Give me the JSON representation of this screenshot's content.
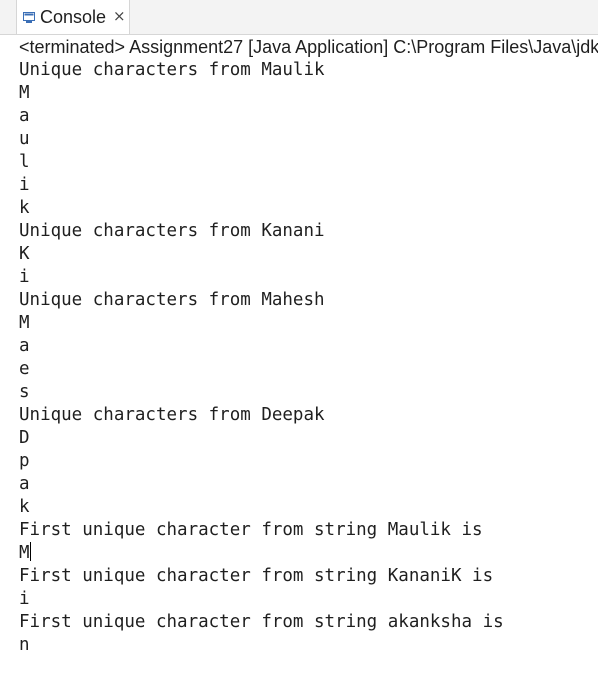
{
  "tab": {
    "label": "Console",
    "close_glyph": "×",
    "icon": "console-icon"
  },
  "status": "<terminated> Assignment27 [Java Application] C:\\Program Files\\Java\\jdk-",
  "console_lines": [
    "Unique characters from Maulik",
    "M",
    "a",
    "u",
    "l",
    "i",
    "k",
    "Unique characters from Kanani",
    "K",
    "i",
    "Unique characters from Mahesh",
    "M",
    "a",
    "e",
    "s",
    "Unique characters from Deepak",
    "D",
    "p",
    "a",
    "k",
    "First unique character from string Maulik is",
    "M",
    "First unique character from string KananiK is",
    "i",
    "First unique character from string akanksha is",
    "n"
  ],
  "caret_after_line": 21,
  "colors": {
    "text": "#1f1f1f",
    "tab_background": "#ffffff",
    "tabbar_background": "#f3f3f3",
    "icon_blue": "#3b6fb6"
  }
}
